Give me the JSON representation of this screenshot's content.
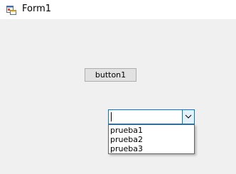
{
  "window": {
    "title": "Form1",
    "icon": "winforms-app-icon"
  },
  "main": {
    "button_label": "button1"
  },
  "combobox": {
    "value": "",
    "expanded": true,
    "options": [
      "prueba1",
      "prueba2",
      "prueba3"
    ]
  },
  "colors": {
    "form_background": "#f0f0f0",
    "title_background": "#ffffff",
    "focus_border": "#0078d7",
    "button_face": "#e1e1e1",
    "button_border": "#adadad"
  }
}
